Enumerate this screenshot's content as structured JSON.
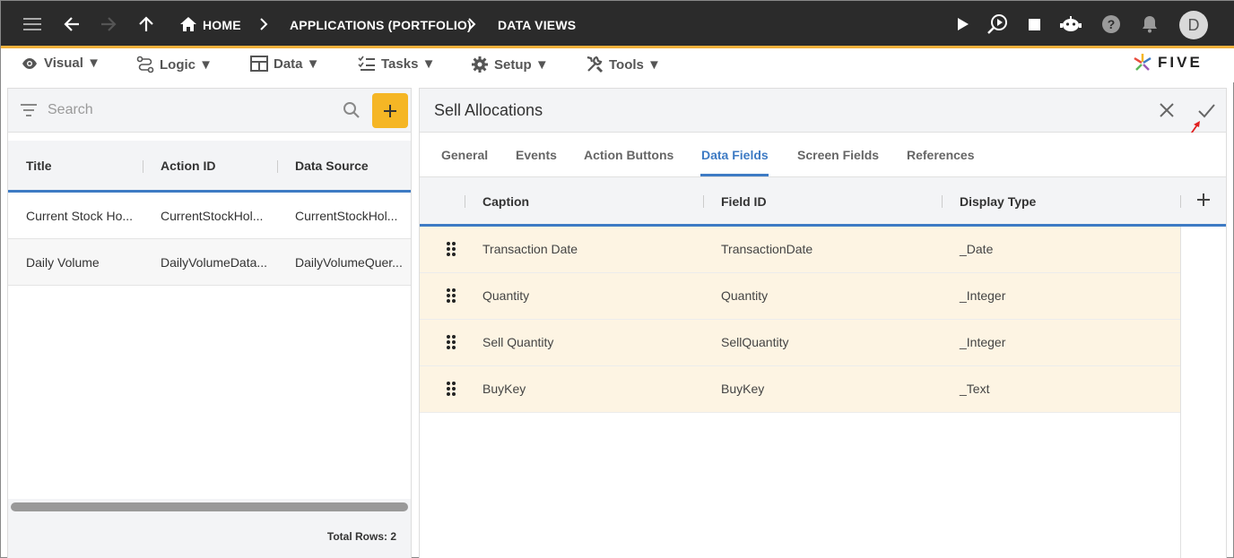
{
  "topbar": {
    "breadcrumbs": [
      "HOME",
      "APPLICATIONS (PORTFOLIO)",
      "DATA VIEWS"
    ],
    "avatar_initial": "D",
    "accent_color": "#f2b13c"
  },
  "menubar": {
    "items": [
      "Visual ▼",
      "Logic ▼",
      "Data ▼",
      "Tasks ▼",
      "Setup ▼",
      "Tools ▼"
    ],
    "logo_text": "FIVE"
  },
  "left": {
    "search_placeholder": "Search",
    "columns": [
      "Title",
      "Action ID",
      "Data Source"
    ],
    "rows": [
      [
        "Current Stock Ho...",
        "CurrentStockHol...",
        "CurrentStockHol..."
      ],
      [
        "Daily Volume",
        "DailyVolumeData...",
        "DailyVolumeQuer..."
      ]
    ],
    "total_rows": "Total Rows: 2"
  },
  "right": {
    "title": "Sell Allocations",
    "tabs": [
      "General",
      "Events",
      "Action Buttons",
      "Data Fields",
      "Screen Fields",
      "References"
    ],
    "active_tab": "Data Fields",
    "columns": [
      "Caption",
      "Field ID",
      "Display Type"
    ],
    "rows": [
      [
        "Transaction Date",
        "TransactionDate",
        "_Date"
      ],
      [
        "Quantity",
        "Quantity",
        "_Integer"
      ],
      [
        "Sell Quantity",
        "SellQuantity",
        "_Integer"
      ],
      [
        "BuyKey",
        "BuyKey",
        "_Text"
      ]
    ]
  }
}
